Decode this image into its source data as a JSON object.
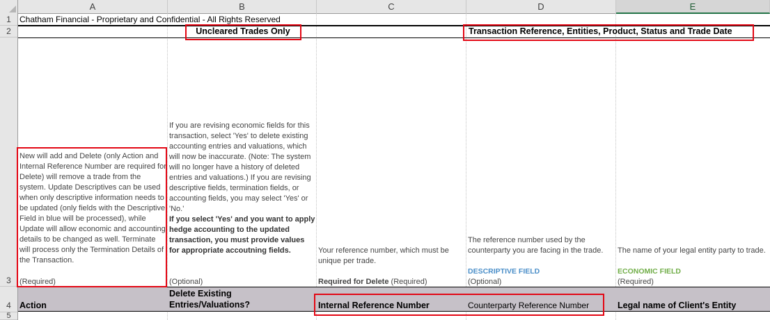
{
  "columns": [
    "A",
    "B",
    "C",
    "D",
    "E"
  ],
  "rows": [
    "1",
    "2",
    "3",
    "4",
    "5"
  ],
  "row1": {
    "a": "Chatham Financial - Proprietary and Confidential - All Rights Reserved"
  },
  "row2": {
    "b": "Uncleared Trades Only",
    "d": "Transaction Reference, Entities, Product, Status and Trade Date"
  },
  "row3": {
    "a_desc": "New will add and Delete (only Action and Internal Reference Number are required for Delete) will remove a trade from the system. Update Descriptives can be used when only descriptive information needs to be updated (only fields with the Descriptive Field in blue will be processed), while Update will allow economic and accounting details to be changed as well. Terminate will process only the Termination Details of the Transaction.",
    "a_req": "(Required)",
    "b_desc": "If you are revising economic fields for this transaction, select 'Yes' to delete existing accounting entries and valuations, which will now be inaccurate. (Note: The system will no longer have a history of deleted entries and valuations.) If you are revising descriptive fields, termination fields, or accounting fields, you may select 'Yes' or 'No.'",
    "b_bold": "If you select 'Yes' and you want to apply hedge accounting to the updated transaction, you must provide values for appropriate accoutning fields.",
    "b_req": "(Optional)",
    "c_desc": "Your reference number, which must be unique per trade.",
    "c_req_bold": "Required for Delete",
    "c_req": "(Required)",
    "d_desc": "The reference number used by the counterparty you are facing in the trade.",
    "d_field": "DESCRIPTIVE FIELD",
    "d_req": "(Optional)",
    "e_desc": "The name of your legal entity party to trade.",
    "e_field": "ECONOMIC FIELD",
    "e_req": "(Required)"
  },
  "row4": {
    "a": "Action",
    "b": "Delete Existing Entries/Valuations?",
    "c": "Internal Reference Number",
    "d": "Counterparty Reference Number",
    "e": "Legal name of Client's Entity"
  },
  "colors": {
    "descriptive": "#4a8ec8",
    "economic": "#70ad47",
    "highlight": "#e30613",
    "header_fill": "#c6c1c8"
  }
}
